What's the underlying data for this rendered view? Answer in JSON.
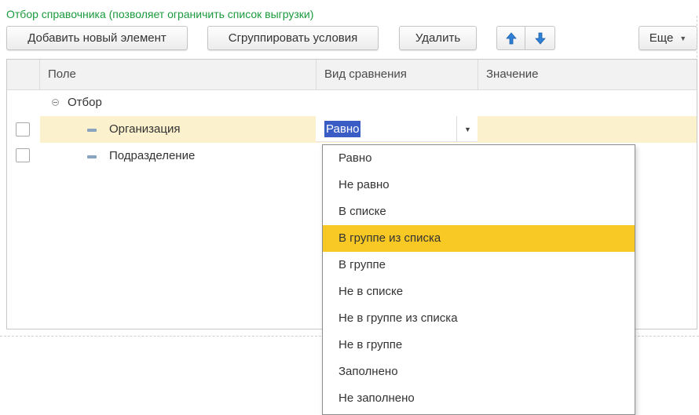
{
  "form": {
    "title": "Отбор справочника (позволяет ограничить список выгрузки)"
  },
  "toolbar": {
    "add_label": "Добавить новый элемент",
    "group_label": "Сгруппировать условия",
    "delete_label": "Удалить",
    "move_up_icon": "arrow-up-icon",
    "move_down_icon": "arrow-down-icon",
    "more_label": "Еще"
  },
  "grid": {
    "headers": {
      "field": "Поле",
      "comparison": "Вид сравнения",
      "value": "Значение"
    },
    "group_label": "Отбор",
    "rows": [
      {
        "field": "Организация",
        "comparison": "Равно",
        "value": "",
        "checked": false,
        "selected": true
      },
      {
        "field": "Подразделение",
        "comparison": "",
        "value": "",
        "checked": false,
        "selected": false
      }
    ]
  },
  "dropdown": {
    "options": [
      "Равно",
      "Не равно",
      "В списке",
      "В группе из списка",
      "В группе",
      "Не в списке",
      "Не в группе из списка",
      "Не в группе",
      "Заполнено",
      "Не заполнено"
    ],
    "highlighted_option": "В группе из списка"
  },
  "colors": {
    "title_green": "#1a9a3c",
    "highlight_yellow": "#f8c924",
    "selected_row": "#fbf1cc",
    "selection_blue": "#3a5cc5",
    "arrow_blue": "#2f7fd6"
  }
}
